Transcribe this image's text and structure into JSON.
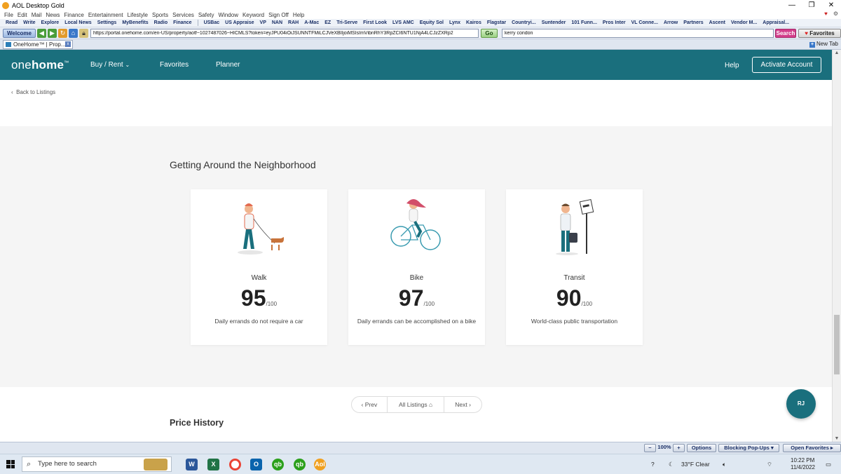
{
  "aol": {
    "window_title": "AOL Desktop Gold",
    "menu": [
      "File",
      "Edit",
      "Mail",
      "News",
      "Finance",
      "Entertainment",
      "Lifestyle",
      "Sports",
      "Services",
      "Safety",
      "Window",
      "Keyword",
      "Sign Off",
      "Help"
    ],
    "favorites_bar": [
      "Read",
      "Write",
      "Explore",
      "Local News",
      "Settings",
      "MyBenefits",
      "Radio",
      "Finance",
      "USBac",
      "US Appraise",
      "VP",
      "NAN",
      "RAH",
      "A-Mac",
      "EZ",
      "Tri-Serve",
      "First Look",
      "LVS AMC",
      "Equity Sol",
      "Lynx",
      "Kairos",
      "Flagstar",
      "Countryi...",
      "Suntender",
      "101 Funn...",
      "Pros Inter",
      "VL Conne...",
      "Arrow",
      "Partners",
      "Ascent",
      "Vendor M...",
      "Appraisal..."
    ],
    "welcome_label": "Welcome",
    "url": "https://portal.onehome.com/en-US/property/aotf~1027487026~HICMLS?token=eyJPU04iOiJSUNNTFMiLCJVeXBlIjoiMSIsImVibnRhY3RpZCI6NTU1NjA4LCJzZXRp2",
    "go_label": "Go",
    "search_value": "kerry condon",
    "search_label": "Search",
    "favorites_label": "Favorites",
    "tab_label": "OneHome™ | Prop...",
    "new_tab_label": "New Tab",
    "status": {
      "zoom": "100%",
      "zoom_plus": "+",
      "options": "Options",
      "blocking": "Blocking Pop-Ups",
      "open_favorites": "Open Favorites"
    }
  },
  "onehome": {
    "logo_pre": "one",
    "logo_bold": "home",
    "logo_tm": "™",
    "nav": {
      "buy_rent": "Buy / Rent",
      "favorites": "Favorites",
      "planner": "Planner",
      "help": "Help",
      "activate": "Activate Account"
    },
    "back_link": "Back to Listings",
    "section_title": "Getting Around the Neighborhood",
    "cards": [
      {
        "title": "Walk",
        "score": "95",
        "max": "/100",
        "desc": "Daily errands do not require a car"
      },
      {
        "title": "Bike",
        "score": "97",
        "max": "/100",
        "desc": "Daily errands can be accomplished on a bike"
      },
      {
        "title": "Transit",
        "score": "90",
        "max": "/100",
        "desc": "World-class public transportation"
      }
    ],
    "pager": {
      "prev": "Prev",
      "all": "All Listings",
      "next": "Next"
    },
    "price_history_title": "Price History",
    "badge": "RJ"
  },
  "taskbar": {
    "search_placeholder": "Type here to search",
    "weather": "33°F  Clear",
    "time": "10:22 PM",
    "date": "11/4/2022"
  },
  "colors": {
    "teal": "#1a6f7d",
    "section_bg": "#f5f5f5"
  }
}
